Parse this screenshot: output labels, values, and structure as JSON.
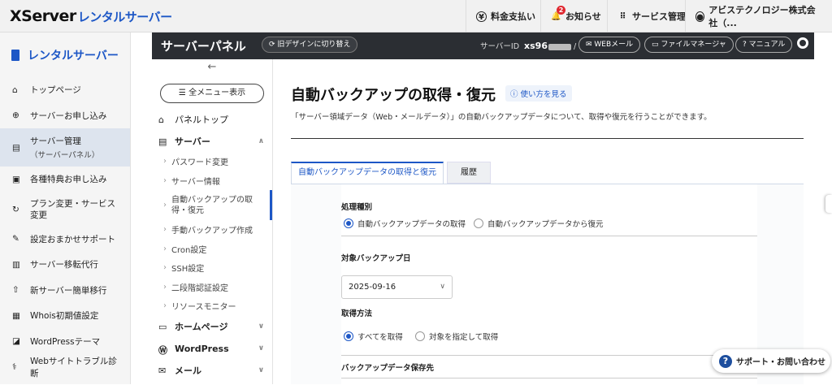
{
  "header": {
    "logo_x": "XServer",
    "logo_rs": "レンタルサーバー",
    "nav": [
      "料金支払い",
      "お知らせ",
      "サービス管理",
      "アビステクノロジー株式会社（..."
    ],
    "notice_badge": "2"
  },
  "sidebar": {
    "title": "レンタルサーバー",
    "items": [
      {
        "label": "トップページ",
        "icon": "home-icon"
      },
      {
        "label": "サーバーお申し込み",
        "icon": "plus-circle-icon"
      },
      {
        "label": "サーバー管理",
        "sub": "（サーバーパネル）",
        "icon": "server-icon"
      },
      {
        "label": "各種特典お申し込み",
        "icon": "gift-icon"
      },
      {
        "label": "プラン変更・サービス変更",
        "icon": "refresh-icon"
      },
      {
        "label": "設定おまかせサポート",
        "icon": "wrench-icon"
      },
      {
        "label": "サーバー移転代行",
        "icon": "truck-icon"
      },
      {
        "label": "新サーバー簡単移行",
        "icon": "upload-icon"
      },
      {
        "label": "Whois初期値設定",
        "icon": "document-icon"
      },
      {
        "label": "WordPressテーマ",
        "icon": "theme-icon"
      },
      {
        "label": "Webサイトトラブル診断",
        "icon": "stethoscope-icon"
      }
    ]
  },
  "panelbar": {
    "title": "サーバーパネル",
    "old_design": "旧デザインに切り替え",
    "server_id_label": "サーバーID",
    "server_id": "xs96",
    "webmail": "WEBメール",
    "file_manager": "ファイルマネージャ",
    "manual": "マニュアル"
  },
  "menu": {
    "back": "←",
    "all_menu": "全メニュー表示",
    "panel_top": "パネルトップ",
    "server": "サーバー",
    "server_items": [
      "パスワード変更",
      "サーバー情報",
      "自動バックアップの取得・復元",
      "手動バックアップ作成",
      "Cron設定",
      "SSH設定",
      "二段階認証設定",
      "リソースモニター"
    ],
    "homepage": "ホームページ",
    "wordpress": "WordPress",
    "mail": "メール"
  },
  "main": {
    "title": "自動バックアップの取得・復元",
    "help": "使い方を見る",
    "description": "「サーバー領域データ（Web・メールデータ）」の自動バックアップデータについて、取得や復元を行うことができます。",
    "tabs": [
      "自動バックアップデータの取得と復元",
      "履歴"
    ],
    "process_label": "処理種別",
    "process_options": [
      "自動バックアップデータの取得",
      "自動バックアップデータから復元"
    ],
    "date_label": "対象バックアップ日",
    "date_value": "2025-09-16",
    "method_label": "取得方法",
    "method_options": [
      "すべてを取得",
      "対象を指定して取得"
    ],
    "dest_label": "バックアップデータ保存先"
  },
  "support": "サポート・お問い合わせ",
  "colors": {
    "accent": "#1d57c6",
    "dark_bar": "#2b2e33"
  }
}
